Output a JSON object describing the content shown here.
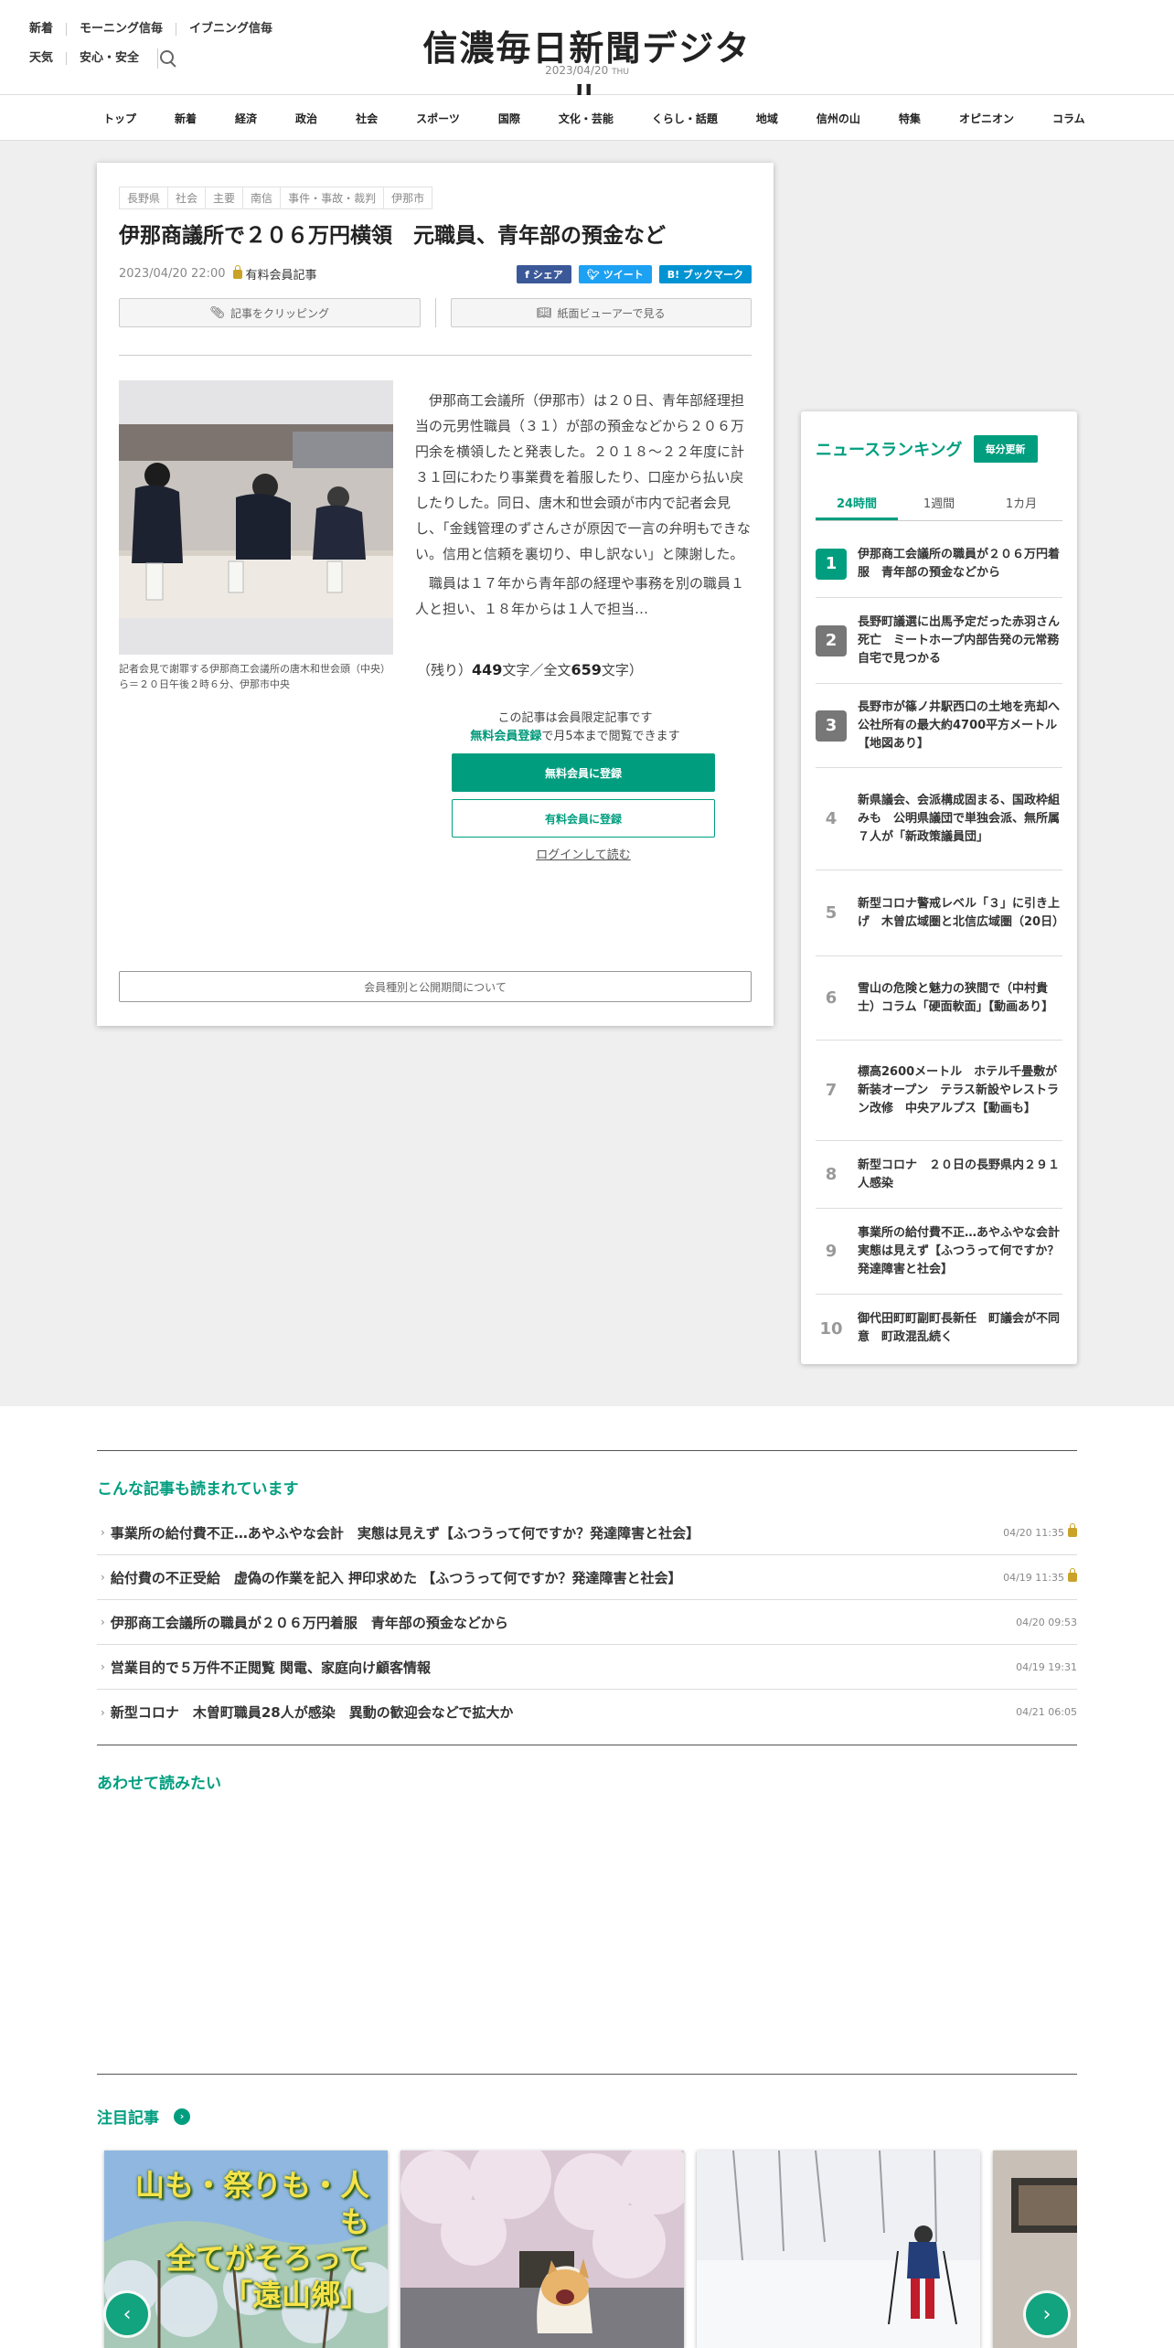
{
  "header": {
    "util_row1": [
      "新着",
      "モーニング信毎",
      "イブニング信毎"
    ],
    "util_row2": [
      "天気",
      "安心・安全"
    ],
    "logo": "信濃毎日新聞デジタル",
    "date": "2023/04/20",
    "weekday": "THU"
  },
  "nav": [
    "トップ",
    "新着",
    "経済",
    "政治",
    "社会",
    "スポーツ",
    "国際",
    "文化・芸能",
    "くらし・話題",
    "地域",
    "信州の山",
    "特集",
    "オピニオン",
    "コラム"
  ],
  "article": {
    "tags": [
      "長野県",
      "社会",
      "主要",
      "南信",
      "事件・事故・裁判",
      "伊那市"
    ],
    "title": "伊那商議所で２０６万円横領　元職員、青年部の預金など",
    "datetime": "2023/04/20 22:00",
    "paid_label": "有料会員記事",
    "share": {
      "facebook": "f シェア",
      "twitter": "ツイート",
      "hatena": "B! ブックマーク"
    },
    "clip_label": "記事をクリッピング",
    "viewer_label": "紙面ビューアーで見る",
    "caption": "記者会見で謝罪する伊那商工会議所の唐木和世会頭（中央）ら＝２０日午後２時６分、伊那市中央",
    "paragraph1": "伊那商工会議所（伊那市）は２０日、青年部経理担当の元男性職員（３１）が部の預金などから２０６万円余を横領したと発表した。２０１８～２２年度に計３１回にわたり事業費を着服したり、口座から払い戻したりした。同日、唐木和世会頭が市内で記者会見し、「金銭管理のずさんさが原因で一言の弁明もできない。信用と信頼を裏切り、申し訳ない」と陳謝した。",
    "paragraph2": "職員は１７年から青年部の経理や事務を別の職員１人と担い、１８年からは１人で担当…",
    "remain_prefix": "（残り）",
    "remain_count": "449",
    "remain_mid": "文字／全文",
    "total_count": "659",
    "remain_suffix": "文字）",
    "member_notice": "この記事は会員限定記事です",
    "free_link": "無料会員登録",
    "free_suffix": "で月5本まで閲覧できます",
    "btn_free": "無料会員に登録",
    "btn_paid": "有料会員に登録",
    "login": "ログインして読む",
    "plan_btn": "会員種別と公開期間について"
  },
  "ranking": {
    "title": "ニュースランキング",
    "update": "毎分更新",
    "tabs": [
      "24時間",
      "1週間",
      "1カ月"
    ],
    "items": [
      {
        "num": "1",
        "text": "伊那商工会議所の職員が２０６万円着服　青年部の預金などから"
      },
      {
        "num": "2",
        "text": "長野町議選に出馬予定だった赤羽さん死亡　ミートホープ内部告発の元常務　自宅で見つかる"
      },
      {
        "num": "3",
        "text": "長野市が篠ノ井駅西口の土地を売却へ　公社所有の最大約4700平方メートル【地図あり】"
      },
      {
        "num": "4",
        "text": "新県議会、会派構成固まる、国政枠組みも　公明県議団で単独会派、無所属７人が「新政策議員団」"
      },
      {
        "num": "5",
        "text": "新型コロナ警戒レベル「３」に引き上げ　木曽広域圏と北信広域圏（20日）"
      },
      {
        "num": "6",
        "text": "雪山の危険と魅力の狭間で（中村貴士）コラム「硬面軟面」【動画あり】"
      },
      {
        "num": "7",
        "text": "標高2600メートル　ホテル千畳敷が新装オープン　テラス新設やレストラン改修　中央アルプス【動画も】"
      },
      {
        "num": "8",
        "text": "新型コロナ　２０日の長野県内２９１人感染"
      },
      {
        "num": "9",
        "text": "事業所の給付費不正…あやふやな会計　実態は見えず【ふつうって何ですか？発達障害と社会】"
      },
      {
        "num": "10",
        "text": "御代田町町副町長新任　町議会が不同意　町政混乱続く"
      }
    ]
  },
  "also_read": {
    "title": "こんな記事も読まれています",
    "items": [
      {
        "text": "事業所の給付費不正…あやふやな会計　実態は見えず【ふつうって何ですか？発達障害と社会】",
        "date": "04/20 11:35",
        "locked": true
      },
      {
        "text": "給付費の不正受給　虚偽の作業を記入 押印求めた 【ふつうって何ですか？発達障害と社会】",
        "date": "04/19 11:35",
        "locked": true
      },
      {
        "text": "伊那商工会議所の職員が２０６万円着服　青年部の預金などから",
        "date": "04/20 09:53",
        "locked": false
      },
      {
        "text": "営業目的で５万件不正閲覧 関電、家庭向け顧客情報",
        "date": "04/19 19:31",
        "locked": false
      },
      {
        "text": "新型コロナ　木曽町職員28人が感染　異動の歓迎会などで拡大か",
        "date": "04/21 06:05",
        "locked": false
      }
    ]
  },
  "together": {
    "title": "あわせて読みたい"
  },
  "featured": {
    "title": "注目記事",
    "card1_text1": "山も・祭りも・人も",
    "card1_text2": "全てがそろって",
    "card1_text3": "「遠山郷」"
  }
}
